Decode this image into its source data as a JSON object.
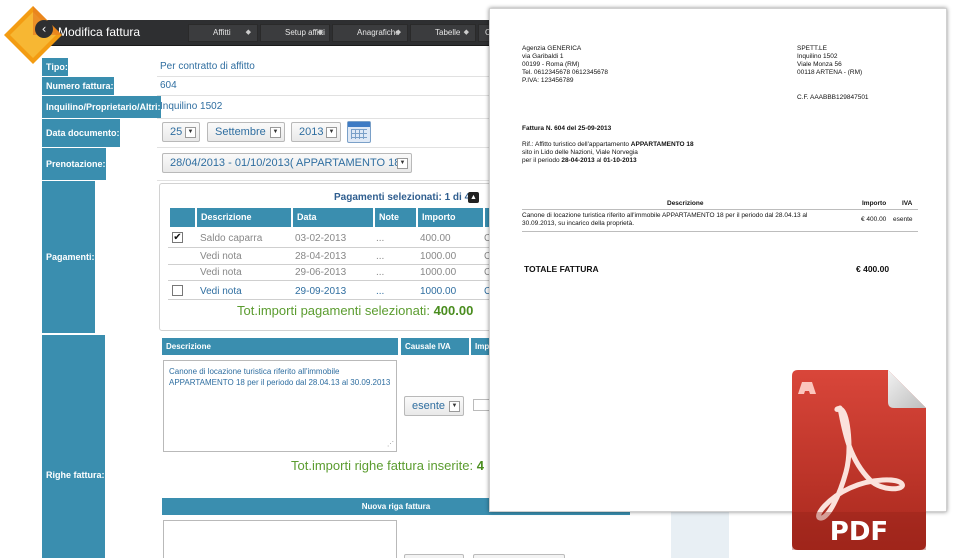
{
  "app": {
    "title": "Modifica fattura",
    "menus": [
      "Affitti",
      "Setup affitti",
      "Anagrafiche",
      "Tabelle",
      "C"
    ]
  },
  "form": {
    "labels": {
      "tipo": "Tipo:",
      "numero": "Numero fattura:",
      "inquilino": "Inquilino/Proprietario/Altri:",
      "data": "Data documento:",
      "prenotazione": "Prenotazione:",
      "pagamenti": "Pagamenti:",
      "righe": "Righe fattura:"
    },
    "tipo": "Per contratto di affitto",
    "numero": "604",
    "inquilino": "Inquilino 1502",
    "data_day": "25",
    "data_month": "Settembre",
    "data_year": "2013",
    "prenotazione": "28/04/2013 - 01/10/2013( APPARTAMENTO 18 )"
  },
  "pagamenti": {
    "title": "Pagamenti selezionati: 1 di 4",
    "headers": [
      "Descrizione",
      "Data",
      "Note",
      "Importo",
      ""
    ],
    "rows": [
      {
        "checked": "✔",
        "descrizione": "Saldo caparra",
        "data": "03-02-2013",
        "note": "...",
        "importo": "400.00",
        "extra": "C"
      },
      {
        "checked": "",
        "descrizione": "Vedi nota",
        "data": "28-04-2013",
        "note": "...",
        "importo": "1000.00",
        "extra": "C"
      },
      {
        "checked": "",
        "descrizione": "Vedi nota",
        "data": "29-06-2013",
        "note": "...",
        "importo": "1000.00",
        "extra": "C"
      },
      {
        "checked": "",
        "descrizione": "Vedi nota",
        "data": "29-09-2013",
        "note": "...",
        "importo": "1000.00",
        "extra": "C"
      }
    ],
    "total_label": "Tot.importi pagamenti selezionati:",
    "total_value": "400.00"
  },
  "righe": {
    "headers": [
      "Descrizione",
      "Causale IVA",
      "Imp"
    ],
    "descrizione": "Canone di locazione turistica riferito all'immobile APPARTAMENTO 18 per il periodo dal 28.04.13 al 30.09.2013",
    "causale": "esente",
    "total_label": "Tot.importi righe fattura inserite:",
    "total_value": "4",
    "nuova_riga": "Nuova riga fattura"
  },
  "invoice": {
    "sender": [
      "Agenzia GENERICA",
      "via Garibaldi 1",
      "00199 - Roma (RM)",
      "Tel. 0612345678 0612345678",
      "P.IVA: 123456789"
    ],
    "recipient": [
      "SPETT.LE",
      "Inquilino 1502",
      "Viale Monza 56",
      "00118 ARTENA - (RM)"
    ],
    "cf": "C.F. AAABBB129847501",
    "fattura_line": "Fattura N. 604 del 25-09-2013",
    "rif_prefix": "Rif.: Affitto turistico dell'appartamento ",
    "rif_bold": "APPARTAMENTO 18",
    "sito": "sito in Lido delle Nazioni, Viale Norvegia",
    "periodo_prefix": "per il periodo ",
    "periodo_from": "28-04-2013",
    "periodo_al": " al ",
    "periodo_to": "01-10-2013",
    "table_headers": [
      "Descrizione",
      "Importo",
      "IVA"
    ],
    "line_desc": [
      "Canone di locazione turistica riferito all'immobile APPARTAMENTO 18 per il periodo dal 28.04.13 al",
      "30.09.2013, su incarico della proprietà."
    ],
    "line_importo": "€ 400.00",
    "line_iva": "esente",
    "totale_label": "TOTALE FATTURA",
    "totale_value": "€ 400.00"
  },
  "pdf_icon": {
    "label": "PDF",
    "color": "#c0392b"
  }
}
